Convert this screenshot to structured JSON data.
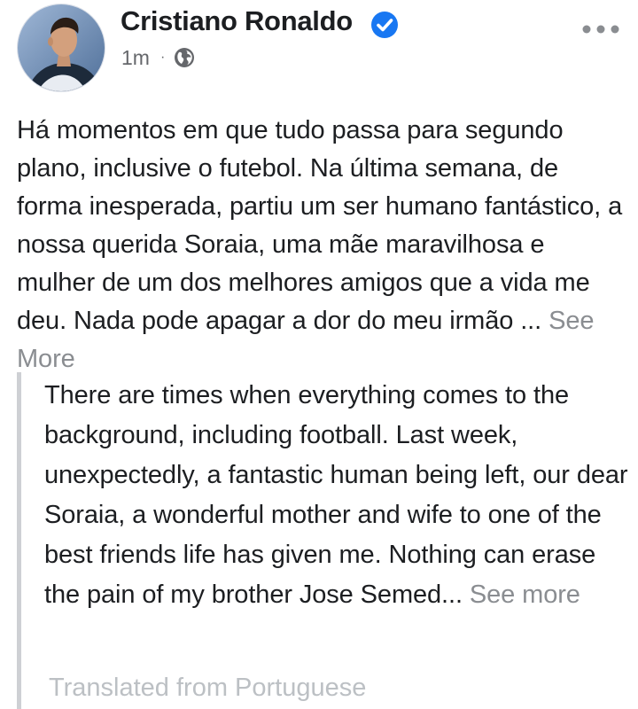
{
  "post": {
    "author": {
      "name": "Cristiano Ronaldo",
      "verified_icon": "verified-badge-icon",
      "avatar": "profile-photo"
    },
    "meta": {
      "time": "1m",
      "separator": "·",
      "audience_icon": "globe-icon"
    },
    "menu_icon": "more-options-icon",
    "original_text": "Há momentos em que tudo passa para segundo plano, inclusive o futebol. Na última semana, de forma inesperada, partiu um ser humano fantástico, a nossa querida Soraia, uma mãe maravilhosa e mulher de um dos melhores amigos que a vida me deu. Nada pode apagar a dor do meu irmão ...",
    "see_more_label": "See More",
    "translation": {
      "text": "There are times when everything comes to the background, including football. Last week, unexpectedly, a fantastic human being left, our dear Soraia, a wonderful mother and wife to one of the best friends life has given me. Nothing can erase the pain of my brother Jose Semed...",
      "see_more_label": "See more",
      "label": "Translated from Portuguese"
    }
  },
  "colors": {
    "primary_text": "#1c1e21",
    "secondary_text": "#65676b",
    "see_more": "#8a8d91",
    "verified_blue": "#1877f2",
    "quote_bar": "#ced0d4"
  }
}
